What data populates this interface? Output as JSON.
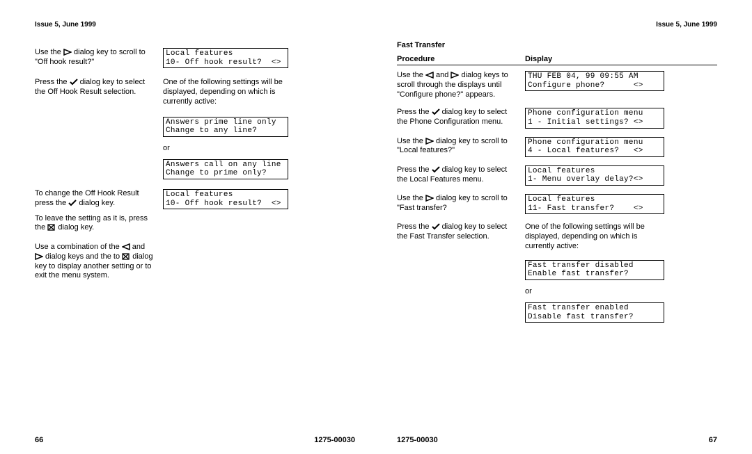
{
  "left": {
    "header": "Issue 5, June 1999",
    "rows": [
      {
        "proc": [
          "Use the ",
          "tri-right",
          " dialog key to scroll to \"Off hook result?\""
        ],
        "disp_lcd": "Local features\n10- Off hook result?  <>"
      },
      {
        "proc": [
          "Press the ",
          "check",
          " dialog key to select the Off Hook Result selection."
        ],
        "disp_text": "One of the following settings will be displayed, depending on which is currently active:"
      },
      {
        "disp_lcd_stack": [
          "Answers prime line only\nChange to any line?",
          "or",
          "Answers call on any line\nChange to prime only?"
        ]
      },
      {
        "proc": [
          "To change the Off Hook Result press the ",
          "check",
          " dialog key."
        ],
        "proc2": [
          "To leave the  setting as it is, press the ",
          "box-x",
          " dialog key."
        ],
        "disp_lcd": "Local features\n10- Off hook result?  <>"
      },
      {
        "proc": [
          "Use a combination of the ",
          "tri-left",
          " and ",
          "tri-right",
          " dialog keys and the to ",
          "box-x",
          " dialog key to display another setting or to exit the menu system."
        ]
      }
    ],
    "footer_left": "66",
    "footer_right": "1275-00030"
  },
  "right": {
    "header": "Issue 5, June 1999",
    "section_title": "Fast Transfer",
    "col1": "Procedure",
    "col2": "Display",
    "rows": [
      {
        "proc": [
          "Use the ",
          "tri-left",
          " and ",
          "tri-right",
          " dialog keys to scroll through the displays until \"Configure phone?\" appears."
        ],
        "disp_lcd": "THU FEB 04, 99 09:55 AM\nConfigure phone?      <>"
      },
      {
        "proc": [
          "Press the ",
          "check",
          " dialog key to select the Phone Configuration menu."
        ],
        "disp_lcd": "Phone configuration menu\n1 - Initial settings? <>"
      },
      {
        "proc": [
          "Use the ",
          "tri-right",
          " dialog key to scroll to \"Local features?\""
        ],
        "disp_lcd": "Phone configuration menu\n4 - Local features?   <>"
      },
      {
        "proc": [
          "Press the ",
          "check",
          " dialog key to select the Local Features menu."
        ],
        "disp_lcd": "Local features\n1- Menu overlay delay?<>"
      },
      {
        "proc": [
          "Use the ",
          "tri-right",
          " dialog key to scroll to \"Fast transfer?"
        ],
        "disp_lcd": "Local features\n11- Fast transfer?    <>"
      },
      {
        "proc": [
          "Press the ",
          "check",
          " dialog key to select the Fast Transfer selection."
        ],
        "disp_text": "One of the following settings will be displayed, depending on which is currently active:"
      },
      {
        "disp_lcd_stack": [
          "Fast transfer disabled\nEnable fast transfer?",
          "or",
          "Fast transfer enabled\nDisable fast transfer?"
        ]
      }
    ],
    "footer_left": "1275-00030",
    "footer_right": "67"
  }
}
